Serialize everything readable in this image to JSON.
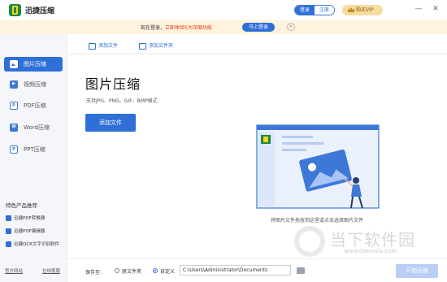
{
  "app": {
    "title": "迅捷压缩"
  },
  "auth": {
    "login": "登录",
    "register": "注册"
  },
  "vip": {
    "label": "购买VIP"
  },
  "window": {
    "minimize": "—",
    "close": "✕"
  },
  "notice": {
    "text_plain": "现在登录，",
    "text_highlight": "立即体验5大压缩功能",
    "button": "马上登录",
    "close": "✕"
  },
  "sidebar": {
    "items": [
      {
        "label": "图片压缩",
        "icon": "image-icon",
        "active": true
      },
      {
        "label": "视频压缩",
        "icon": "video-icon",
        "active": false
      },
      {
        "label": "PDF压缩",
        "icon": "pdf-icon",
        "active": false
      },
      {
        "label": "Word压缩",
        "icon": "word-icon",
        "active": false
      },
      {
        "label": "PPT压缩",
        "icon": "ppt-icon",
        "active": false
      }
    ],
    "recommend_title": "特色产品推荐",
    "recommend": [
      "迅捷PDF转换器",
      "迅捷PDF编辑器",
      "迅捷OCR文字识别软件"
    ],
    "footer": {
      "website": "官方网站",
      "support": "在线客服"
    }
  },
  "toolbar": {
    "add_file": "添加文件",
    "add_folder": "添加文件夹"
  },
  "main": {
    "title": "图片压缩",
    "subtitle": "支持JPG、PNG、GIF、BMP格式",
    "add_button": "添加文件",
    "drop_hint": "将图片文件拖放到这里或点击选择图片文件"
  },
  "bottom": {
    "save_label": "保存至:",
    "option_original": "原文件夹",
    "option_custom": "自定义",
    "selected": "自定义",
    "path": "C:\\Users\\Administrator\\Documents",
    "start_button": "开始压缩"
  },
  "watermark": {
    "text": "当下软件园",
    "url": "www.downxia.com"
  },
  "colors": {
    "accent": "#2e6fd8",
    "notice_bg": "#fff3dd",
    "highlight": "#e23a1b",
    "vip_bg": "#f7dca0"
  }
}
